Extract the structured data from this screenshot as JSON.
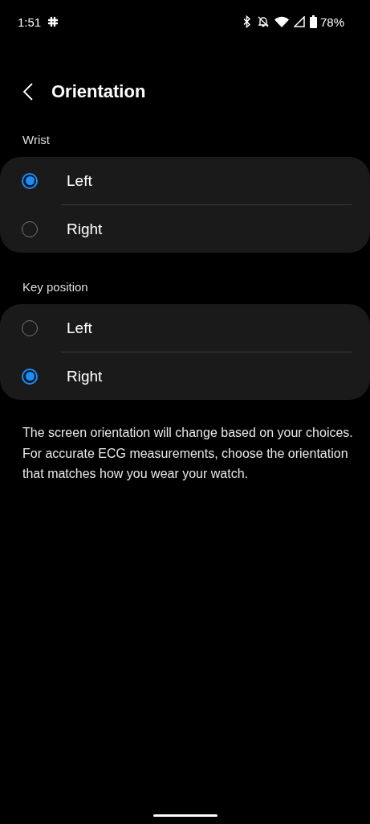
{
  "status_bar": {
    "time": "1:51",
    "battery": "78%"
  },
  "header": {
    "title": "Orientation"
  },
  "groups": [
    {
      "label": "Wrist",
      "options": [
        {
          "label": "Left",
          "selected": true
        },
        {
          "label": "Right",
          "selected": false
        }
      ]
    },
    {
      "label": "Key position",
      "options": [
        {
          "label": "Left",
          "selected": false
        },
        {
          "label": "Right",
          "selected": true
        }
      ]
    }
  ],
  "description": "The screen orientation will change based on your choices. For accurate ECG measurements, choose the orientation that matches how you wear your watch."
}
